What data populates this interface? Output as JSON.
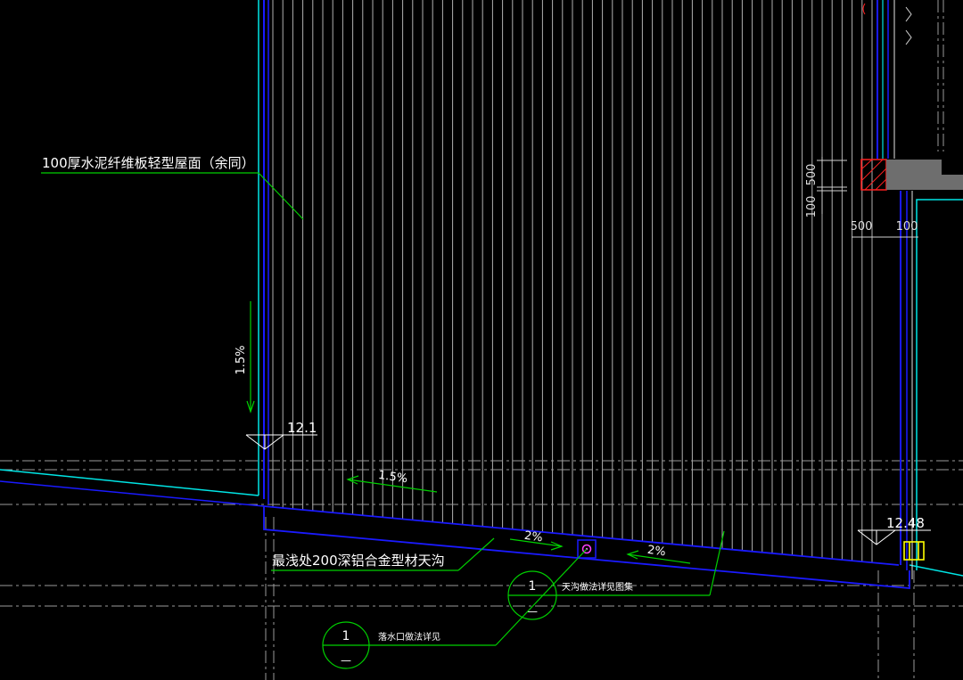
{
  "annotations": {
    "roof_material": "100厚水泥纤维板轻型屋面（余同）",
    "gutter_note": "最浅处200深铝合金型材天沟",
    "slope_vertical": "1.5%",
    "slope_gutter": "1.5%",
    "slope_right": "2%",
    "slope_left": "2%",
    "elevation_left": "12.1",
    "elevation_right": "12.48",
    "gutter_detail_note": "天沟做法详见图集",
    "drain_detail_note": "落水口做法详见"
  },
  "detail_markers": [
    {
      "number": "1",
      "sheet": "—"
    },
    {
      "number": "1",
      "sheet": "—"
    }
  ],
  "dimensions": {
    "dim_500_vertical": "500",
    "dim_100_vertical": "100",
    "dim_500_horizontal": "500",
    "dim_100_horizontal": "100"
  },
  "colors": {
    "background": "#000000",
    "cyan": "#00e5e5",
    "blue": "#1a1aff",
    "green": "#00d000",
    "white": "#ffffff",
    "red": "#ff2020",
    "magenta": "#ff40ff",
    "yellow": "#ffff00",
    "grey": "#6e6e6e"
  }
}
